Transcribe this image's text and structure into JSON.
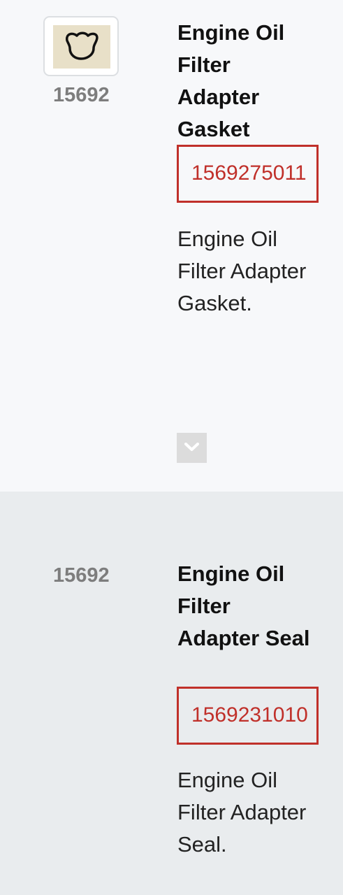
{
  "items": [
    {
      "part_number": "15692",
      "title": "Engine Oil Filter Adapter Gasket",
      "oem_number": "1569275011",
      "description": "Engine Oil Filter Adapter Gasket.",
      "thumbnail_icon": "gasket-thumbnail",
      "expand_icon": "chevron-down-icon"
    },
    {
      "part_number": "15692",
      "title": "Engine Oil Filter Adapter Seal",
      "oem_number": "1569231010",
      "description": "Engine Oil Filter Adapter Seal."
    }
  ],
  "colors": {
    "oem_accent": "#c0302a",
    "row_bg_light": "#f7f8fa",
    "row_bg_gray": "#e9ecee",
    "part_number_text": "#7d7d7d"
  }
}
